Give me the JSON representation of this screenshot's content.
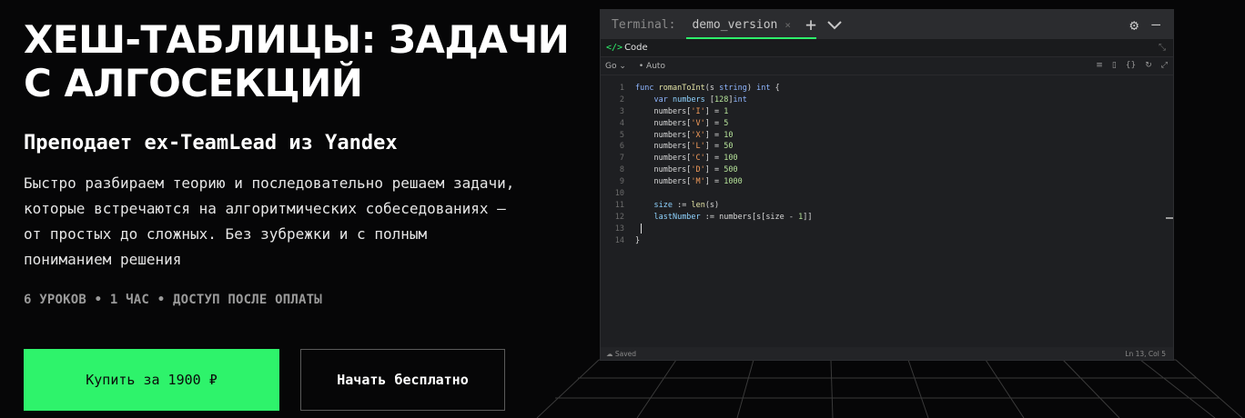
{
  "hero": {
    "title": "ХЕШ-ТАБЛИЦЫ: ЗАДАЧИ С АЛГОСЕКЦИЙ",
    "subtitle": "Преподает ex-TeamLead из Yandex",
    "description": "Быстро разбираем теорию и последовательно решаем задачи, которые встречаются на алгоритмических собеседованиях — от простых до сложных. Без зубрежки и с полным пониманием решения",
    "meta": "6 УРОКОВ • 1 ЧАС • ДОСТУП ПОСЛЕ ОПЛАТЫ",
    "buy_label": "Купить за 1900 ₽",
    "free_label": "Начать бесплатно"
  },
  "editor": {
    "terminal_label": "Terminal:",
    "tab_label": "demo_version",
    "tab_close": "×",
    "plus": "+",
    "gear": "⚙",
    "minimize": "–",
    "code_label": "Code",
    "language": "Go ⌄",
    "mode": "• Auto",
    "status_saved": "☁ Saved",
    "status_pos": "Ln 13, Col 5",
    "lines": [
      "1",
      "2",
      "3",
      "4",
      "5",
      "6",
      "7",
      "8",
      "9",
      "10",
      "11",
      "12",
      "13",
      "14"
    ]
  },
  "colors": {
    "accent": "#2ef36b",
    "background": "#060607",
    "editor_bg": "#1e1f22"
  },
  "icons": {
    "code": "code-icon",
    "expand": "expand-icon",
    "settings": "gear-icon"
  }
}
